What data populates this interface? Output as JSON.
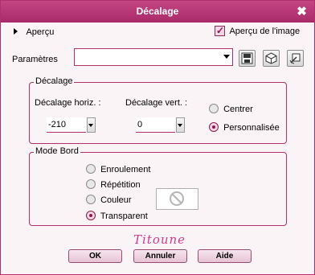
{
  "window": {
    "title": "Décalage"
  },
  "preview": {
    "toggle_label": "Aperçu",
    "image_label": "Aperçu de l'image",
    "image_checked": true
  },
  "params": {
    "label": "Paramètres",
    "value": ""
  },
  "offset": {
    "title": "Décalage",
    "horiz_label": "Décalage horiz. :",
    "horiz_value": "-210",
    "vert_label": "Décalage vert. :",
    "vert_value": "0",
    "center_label": "Centrer",
    "custom_label": "Personnalisée",
    "selected": "custom"
  },
  "edge_mode": {
    "title": "Mode Bord",
    "options": [
      "Enroulement",
      "Répétition",
      "Couleur",
      "Transparent"
    ],
    "selected": "Transparent"
  },
  "signature": "Titoune",
  "buttons": {
    "ok": "OK",
    "cancel": "Annuler",
    "help": "Aide"
  },
  "colors": {
    "accent": "#b0306e",
    "title_bar": "#b83a78"
  },
  "icons": [
    "close-icon",
    "save-icon",
    "randomize-icon",
    "reset-icon",
    "no-color-icon"
  ]
}
